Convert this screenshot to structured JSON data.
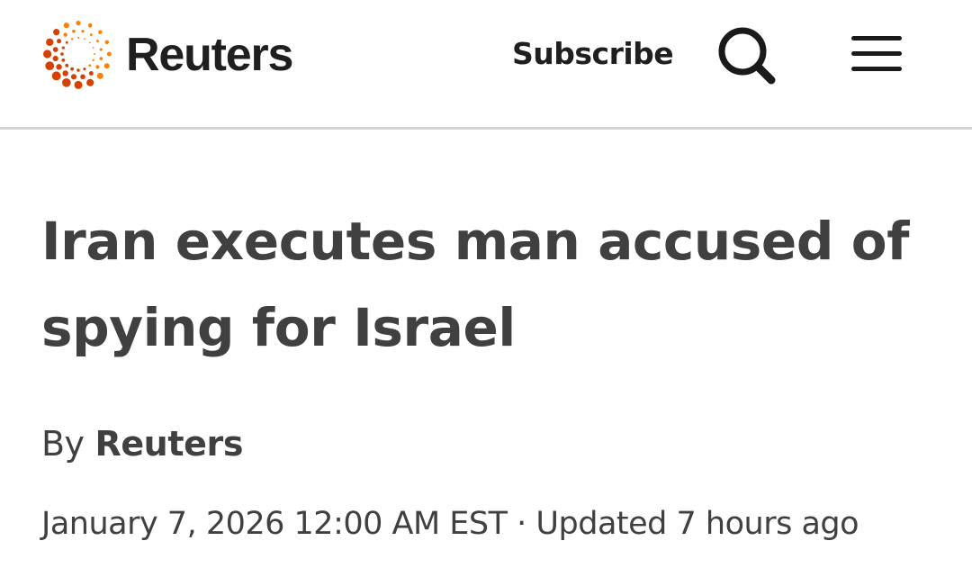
{
  "header": {
    "logo_text": "Reuters",
    "subscribe_label": "Subscribe",
    "search_icon": "search-icon",
    "menu_icon": "hamburger-menu-icon",
    "brand_color": "#ff8000",
    "brand_dark_color": "#d64000"
  },
  "article": {
    "headline": "Iran executes man accused of spying for Israel",
    "byline_prefix": "By",
    "byline_author": "Reuters",
    "published": "January 7, 2026 12:00 AM EST",
    "separator": "·",
    "updated": "Updated 7 hours ago"
  }
}
